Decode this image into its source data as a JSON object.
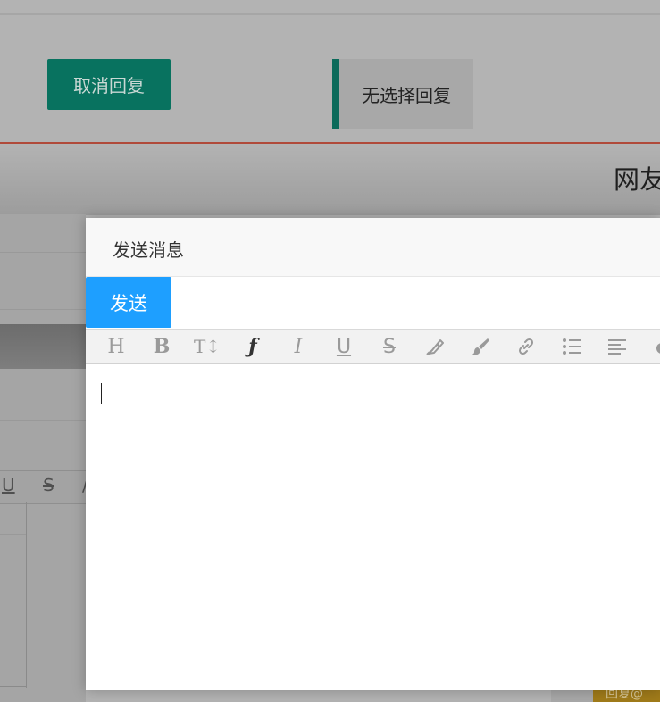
{
  "background": {
    "cancel_reply_label": "取消回复",
    "no_select_reply_label": "无选择回复",
    "netizen_label": "网友",
    "reply_button_fragment": "回复@",
    "toolbar_fragment": [
      "U",
      "S",
      "/"
    ]
  },
  "modal": {
    "title": "发送消息",
    "send_label": "发送",
    "editor_value": "",
    "toolbar": [
      {
        "name": "heading",
        "icon": "heading-icon",
        "glyph": "H"
      },
      {
        "name": "bold",
        "icon": "bold-icon",
        "glyph": "B"
      },
      {
        "name": "font-size",
        "icon": "font-size-icon",
        "glyph": "T↕"
      },
      {
        "name": "font-family",
        "icon": "font-family-icon",
        "glyph": "ƒ"
      },
      {
        "name": "italic",
        "icon": "italic-icon",
        "glyph": "I"
      },
      {
        "name": "underline",
        "icon": "underline-icon",
        "glyph": "U"
      },
      {
        "name": "strikethrough",
        "icon": "strikethrough-icon",
        "glyph": "S"
      },
      {
        "name": "highlight",
        "icon": "highlighter-icon"
      },
      {
        "name": "color",
        "icon": "paintbrush-icon"
      },
      {
        "name": "link",
        "icon": "link-icon"
      },
      {
        "name": "bulleted-list",
        "icon": "list-icon"
      },
      {
        "name": "align",
        "icon": "align-left-icon"
      },
      {
        "name": "more",
        "icon": "more-icon"
      }
    ]
  },
  "colors": {
    "send_button": "#1e9fff",
    "cancel_button": "#08725f",
    "accent_border": "#0b6a5a",
    "divider_red": "#b04a3a"
  }
}
